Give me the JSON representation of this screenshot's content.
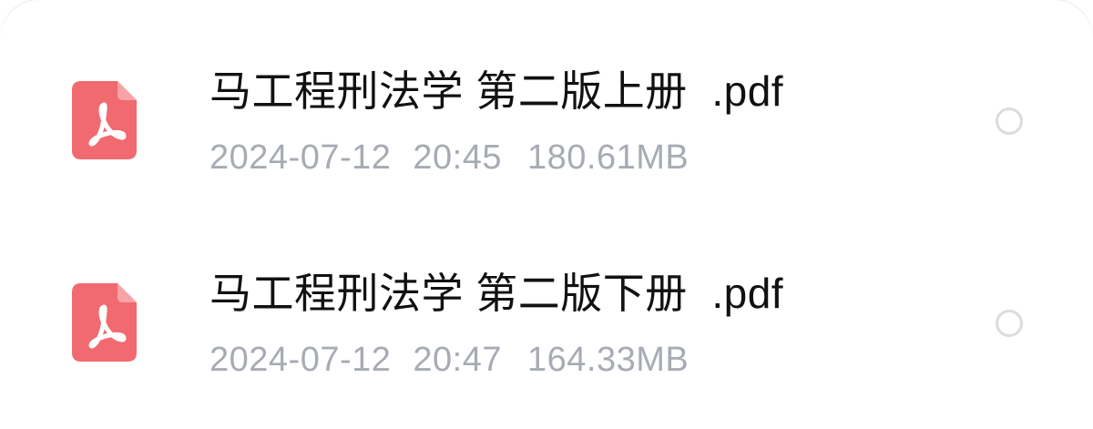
{
  "files": [
    {
      "name": "马工程刑法学 第二版上册  .pdf",
      "date": "2024-07-12",
      "time": "20:45",
      "size": "180.61MB",
      "icon": "pdf-file-icon",
      "selected": false
    },
    {
      "name": "马工程刑法学 第二版下册  .pdf",
      "date": "2024-07-12",
      "time": "20:47",
      "size": "164.33MB",
      "icon": "pdf-file-icon",
      "selected": false
    }
  ],
  "colors": {
    "pdf_icon": "#f06a6f",
    "pdf_icon_fold": "#f8a3a6",
    "name_text": "#111111",
    "meta_text": "#a7abb3",
    "radio_border": "#dcdcdc"
  }
}
